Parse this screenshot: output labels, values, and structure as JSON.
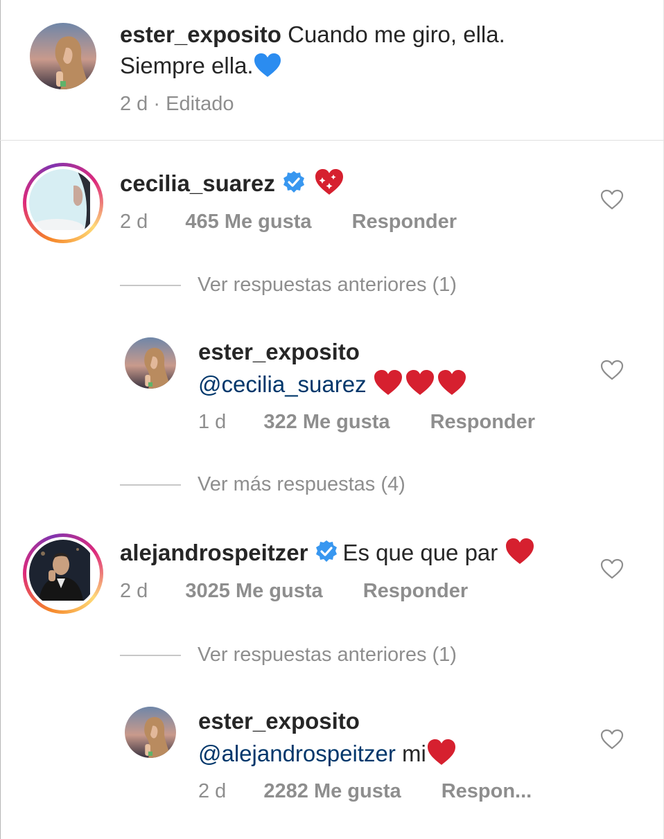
{
  "caption": {
    "username": "ester_exposito",
    "text_line1": "Cuando me giro, ella.",
    "text_line2": "Siempre ella.",
    "emoji": "blue-heart",
    "time": "2 d",
    "separator": "·",
    "edited": "Editado"
  },
  "comments": [
    {
      "username": "cecilia_suarez",
      "verified": true,
      "text": "",
      "emoji": "sparkling-heart",
      "time": "2 d",
      "likes": "465 Me gusta",
      "reply": "Responder",
      "thread_link": "Ver respuestas anteriores (1)",
      "reply_item": {
        "username": "ester_exposito",
        "mention": "@cecilia_suarez",
        "text": "",
        "emoji": "three-red-hearts",
        "time": "1 d",
        "likes": "322 Me gusta",
        "reply": "Responder"
      },
      "more_link": "Ver más respuestas (4)"
    },
    {
      "username": "alejandrospeitzer",
      "verified": true,
      "text": "Es que que par",
      "emoji": "red-heart",
      "time": "2 d",
      "likes": "3025 Me gusta",
      "reply": "Responder",
      "thread_link": "Ver respuestas anteriores (1)",
      "reply_item": {
        "username": "ester_exposito",
        "mention": "@alejandrospeitzer",
        "text": "mi",
        "emoji": "red-heart",
        "time": "2 d",
        "likes": "2282 Me gusta",
        "reply": "Respon..."
      }
    }
  ],
  "colors": {
    "text": "#262626",
    "secondary": "#8e8e8e",
    "mention": "#00376b",
    "verified": "#3897f0",
    "heart_red": "#ed4956",
    "blue_heart": "#2b8cf0"
  }
}
